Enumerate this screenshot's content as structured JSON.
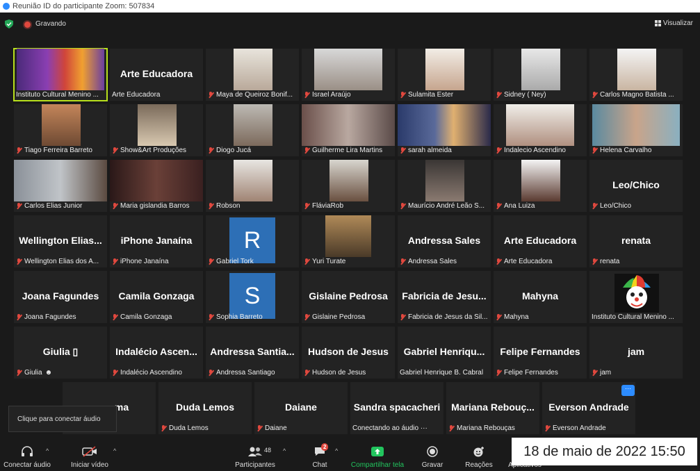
{
  "window": {
    "title": "Reunião ID do participante Zoom: 507834"
  },
  "meeting": {
    "recording_label": "Gravando",
    "view_label": "Visualizar"
  },
  "tiles": {
    "t0": "Instituto Cultural Menino ...",
    "t1_big": "Arte Educadora",
    "t1": "Arte Educadora",
    "t2": "Maya de Queiroz Bonif...",
    "t3": "Israel Araújo",
    "t4": "Sulamita Ester",
    "t5": "Sidney ( Ney)",
    "t6": "Carlos Magno Batista ...",
    "t7": "Tiago Ferreira Barreto",
    "t8": "Show&Art Produções",
    "t9": "Diogo Jucá",
    "t10": "Guilherme Lira Martins",
    "t11": "sarah almeida",
    "t12": "Indalecio Ascendino",
    "t13": "Helena Carvalho",
    "t14": "Carlos Elias Junior",
    "t15": "Maria gislandia Barros",
    "t16": "Robson",
    "t17": "FláviaRob",
    "t18": "Maurício André Leão S...",
    "t19": "Ana Luiza",
    "t20_big": "Leo/Chico",
    "t20": "Leo/Chico",
    "t21_big": "Wellington  Elias...",
    "t21": "Wellington Elias dos A...",
    "t22_big": "iPhone Janaína",
    "t22": "iPhone Janaína",
    "t23_avatar": "R",
    "t23": "Gabriel Tork",
    "t24": "Yuri Turate",
    "t25_big": "Andressa Sales",
    "t25": "Andressa Sales",
    "t26_big": "Arte Educadora",
    "t26": "Arte Educadora",
    "t27_big": "renata",
    "t27": "renata",
    "t28_big": "Joana Fagundes",
    "t28": "Joana Fagundes",
    "t29_big": "Camila Gonzaga",
    "t29": "Camila Gonzaga",
    "t30_avatar": "S",
    "t30": "Sophia Barreto",
    "t31_big": "Gislaine Pedrosa",
    "t31": "Gislaine Pedrosa",
    "t32_big": "Fabricia de Jesu...",
    "t32": "Fabricia de Jesus da Sil...",
    "t33_big": "Mahyna",
    "t33": "Mahyna",
    "t34": "Instituto Cultural Menino ...",
    "t35_big": "Giulia ▯",
    "t35": "Giulia",
    "t36_big": "Indalécio  Ascen...",
    "t36": "Indalécio Ascendino",
    "t37_big": "Andressa  Santia...",
    "t37": "Andressa Santiago",
    "t38_big": "Hudson de Jesus",
    "t38": "Hudson de Jesus",
    "t39_big": "Gabriel  Henriqu...",
    "t39": "Gabriel Henrique B. Cabral",
    "t40_big": "Felipe Fernandes",
    "t40": "Felipe Fernandes",
    "t41_big": "jam",
    "t41": "jam",
    "t42_big": "ma",
    "t43_big": "Duda Lemos",
    "t43": "Duda Lemos",
    "t44_big": "Daiane",
    "t44": "Daiane",
    "t45_big": "Sandra spacacheri",
    "t45": "Conectando ao áudio ···",
    "t46_big": "Mariana  Rebouç...",
    "t46": "Mariana Rebouças",
    "t47_big": "Everson Andrade",
    "t47": "Everson Andrade",
    "more_dots": "···"
  },
  "tooltip": "Clique para conectar áudio",
  "toolbar": {
    "audio": "Conectar áudio",
    "video": "Iniciar vídeo",
    "participants": "Participantes",
    "participants_count": "48",
    "chat": "Chat",
    "chat_badge": "2",
    "share": "Compartilhar tela",
    "record": "Gravar",
    "reactions": "Reações",
    "apps": "Aplicativos"
  },
  "timestamp": "18 de maio de 2022 15:50",
  "colors": {
    "accent": "#2d8cff",
    "share_green": "#22c55e",
    "active_speaker": "#b8e01c",
    "muted_red": "#e0483e"
  }
}
